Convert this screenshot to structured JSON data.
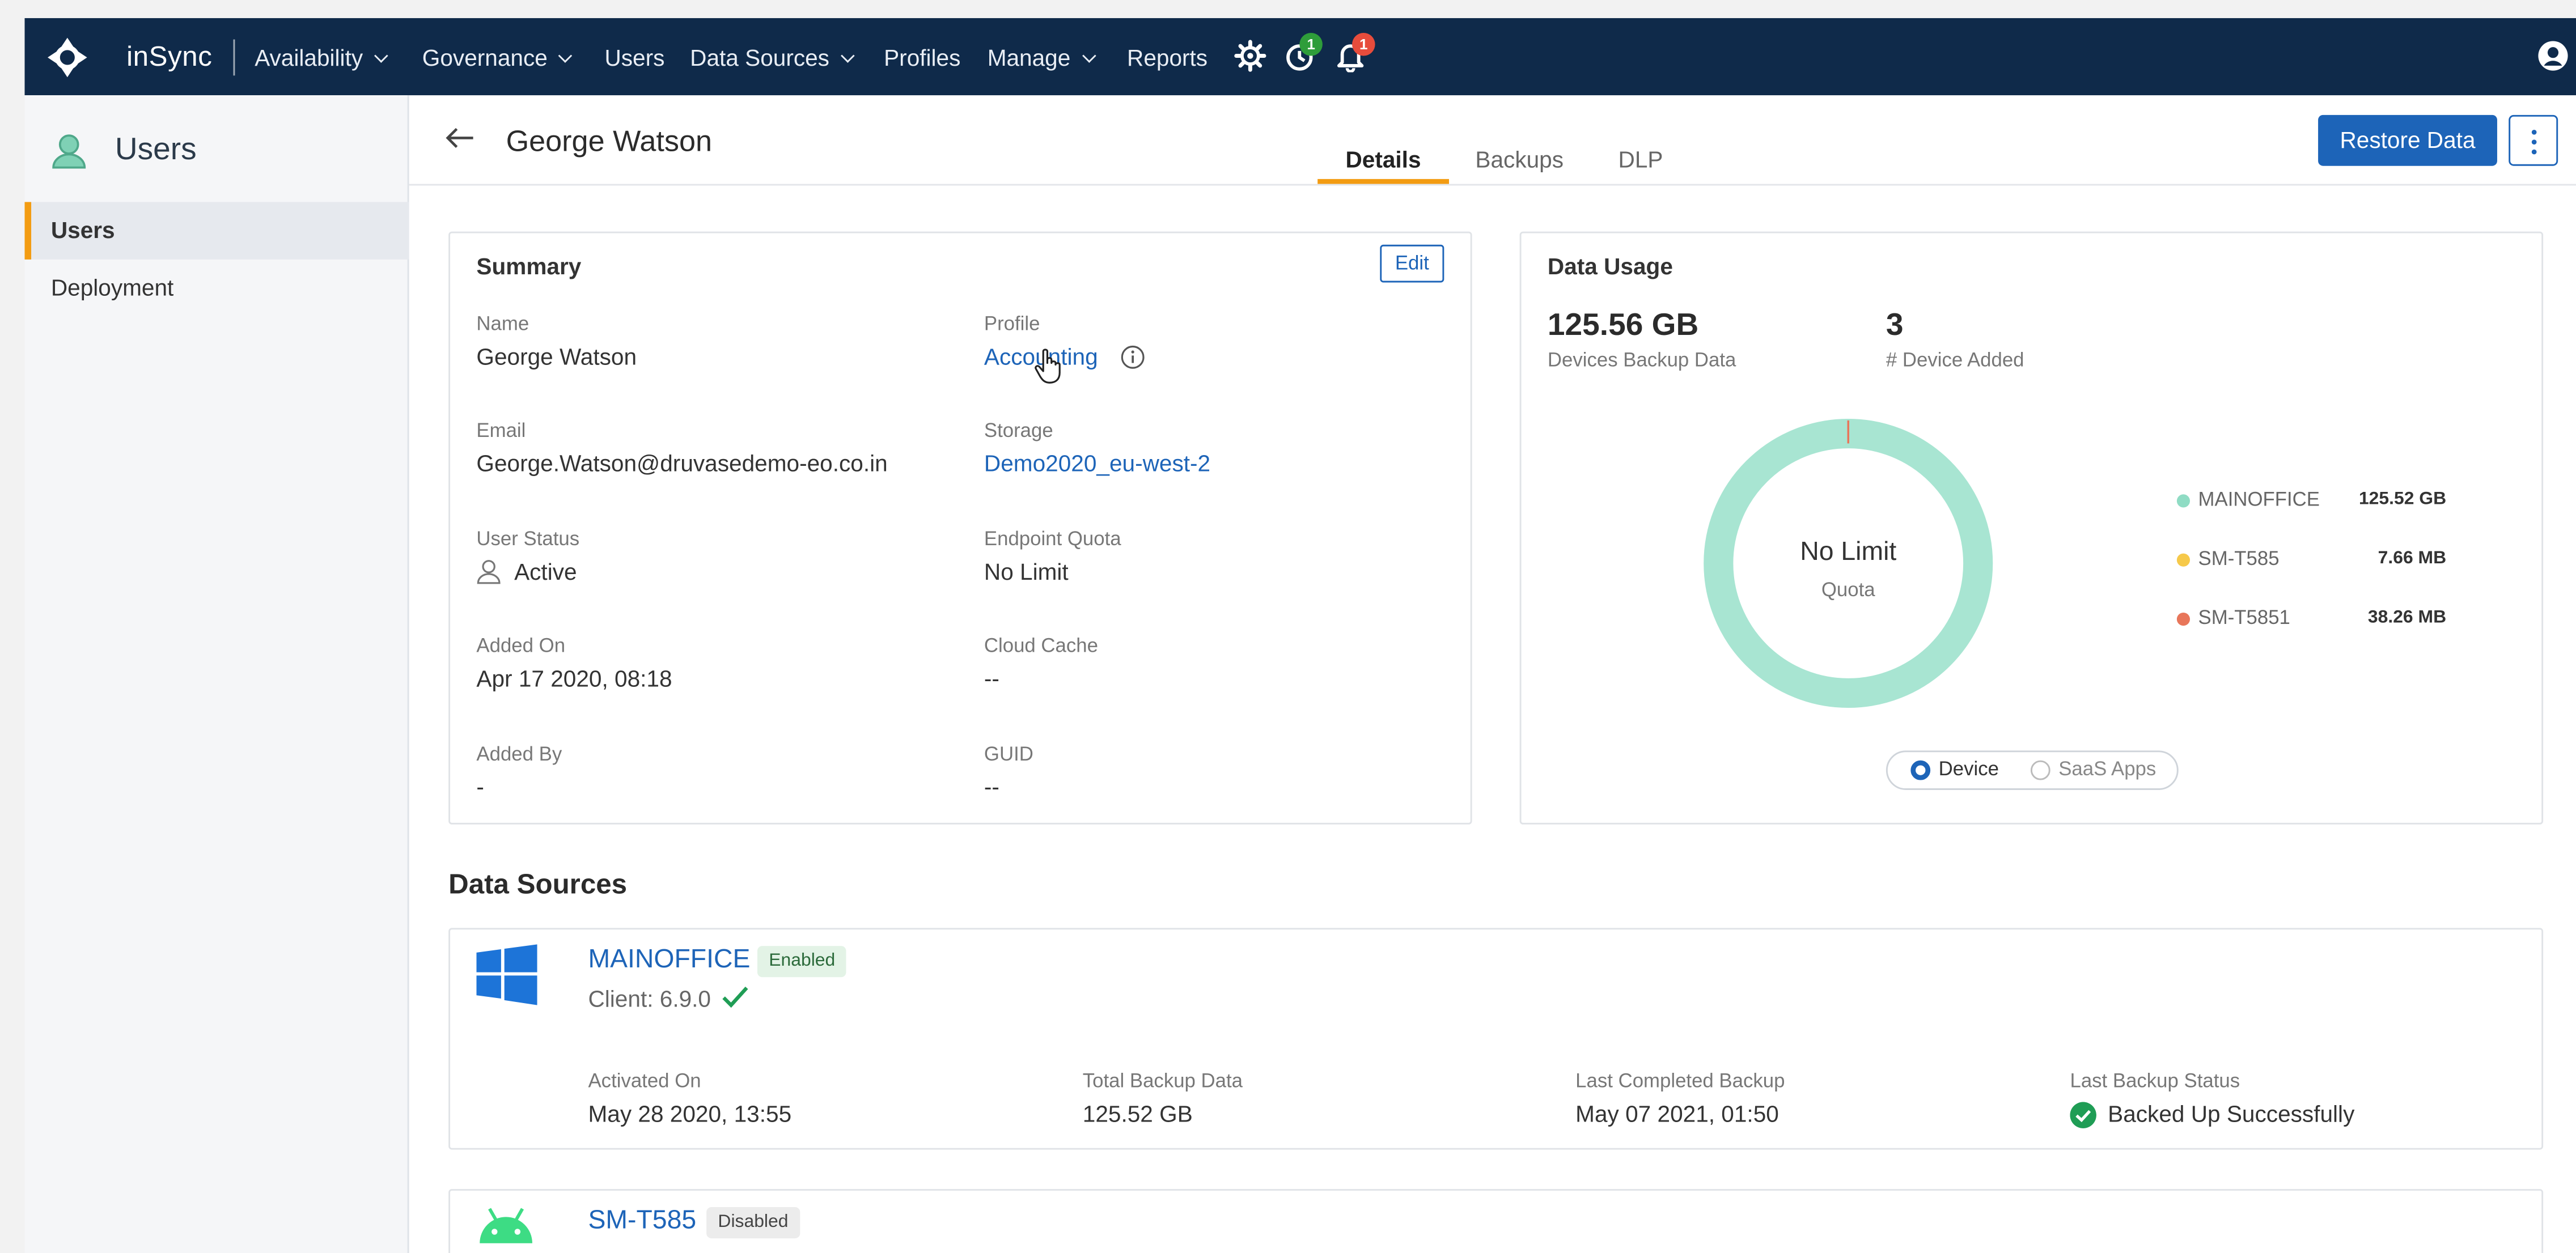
{
  "topnav": {
    "brand": "inSync",
    "items": [
      {
        "label": "Availability",
        "dropdown": true
      },
      {
        "label": "Governance",
        "dropdown": true
      },
      {
        "label": "Users",
        "dropdown": false
      },
      {
        "label": "Data Sources",
        "dropdown": true
      },
      {
        "label": "Profiles",
        "dropdown": false
      },
      {
        "label": "Manage",
        "dropdown": true
      },
      {
        "label": "Reports",
        "dropdown": false
      }
    ],
    "icons": [
      "gear-icon",
      "clock-icon",
      "bell-icon",
      "user-profile-icon"
    ],
    "clock_badge": "1",
    "bell_badge": "1",
    "colors": {
      "bar": "#0f2a4a",
      "clock_badge": "#2e9d3a",
      "bell_badge": "#e74c3c"
    }
  },
  "sidebar": {
    "title": "Users",
    "items": [
      {
        "label": "Users",
        "active": true
      },
      {
        "label": "Deployment",
        "active": false
      }
    ]
  },
  "header": {
    "title": "George Watson",
    "tabs": [
      {
        "label": "Details",
        "active": true
      },
      {
        "label": "Backups",
        "active": false
      },
      {
        "label": "DLP",
        "active": false
      }
    ],
    "restore_label": "Restore Data",
    "accent": "#f39c12",
    "primary": "#1d64b8"
  },
  "summary": {
    "title": "Summary",
    "edit_label": "Edit",
    "fields": {
      "name": {
        "label": "Name",
        "value": "George Watson"
      },
      "profile": {
        "label": "Profile",
        "value": "Accounting"
      },
      "email": {
        "label": "Email",
        "value": "George.Watson@druvasedemo-eo.co.in"
      },
      "storage": {
        "label": "Storage",
        "value": "Demo2020_eu-west-2"
      },
      "user_status": {
        "label": "User Status",
        "value": "Active"
      },
      "endpoint_quota": {
        "label": "Endpoint Quota",
        "value": "No Limit"
      },
      "added_on": {
        "label": "Added On",
        "value": "Apr 17 2020, 08:18"
      },
      "cloud_cache": {
        "label": "Cloud Cache",
        "value": "--"
      },
      "added_by": {
        "label": "Added By",
        "value": "-"
      },
      "guid": {
        "label": "GUID",
        "value": "--"
      }
    }
  },
  "data_usage": {
    "title": "Data Usage",
    "backup_value": "125.56 GB",
    "backup_label": "Devices Backup Data",
    "devices_value": "3",
    "devices_label": "# Device Added",
    "center_text": "No Limit",
    "center_sub": "Quota",
    "legend": [
      {
        "name": "MAINOFFICE",
        "value": "125.52 GB",
        "color": "#8fdcc4"
      },
      {
        "name": "SM-T585",
        "value": "7.66 MB",
        "color": "#f6c94a"
      },
      {
        "name": "SM-T5851",
        "value": "38.26 MB",
        "color": "#e8765a"
      }
    ],
    "toggle": [
      {
        "label": "Device",
        "selected": true
      },
      {
        "label": "SaaS Apps",
        "selected": false
      }
    ]
  },
  "data_sources": {
    "title": "Data Sources",
    "items": [
      {
        "name": "MAINOFFICE",
        "status": "Enabled",
        "client": "Client: 6.9.0",
        "os_icon": "windows-icon",
        "activated_label": "Activated On",
        "activated_value": "May 28 2020, 13:55",
        "total_label": "Total Backup Data",
        "total_value": "125.52 GB",
        "last_label": "Last Completed Backup",
        "last_value": "May 07 2021, 01:50",
        "status_label": "Last Backup Status",
        "status_value": "Backed Up Successfully"
      },
      {
        "name": "SM-T585",
        "status": "Disabled",
        "os_icon": "android-icon"
      }
    ]
  }
}
